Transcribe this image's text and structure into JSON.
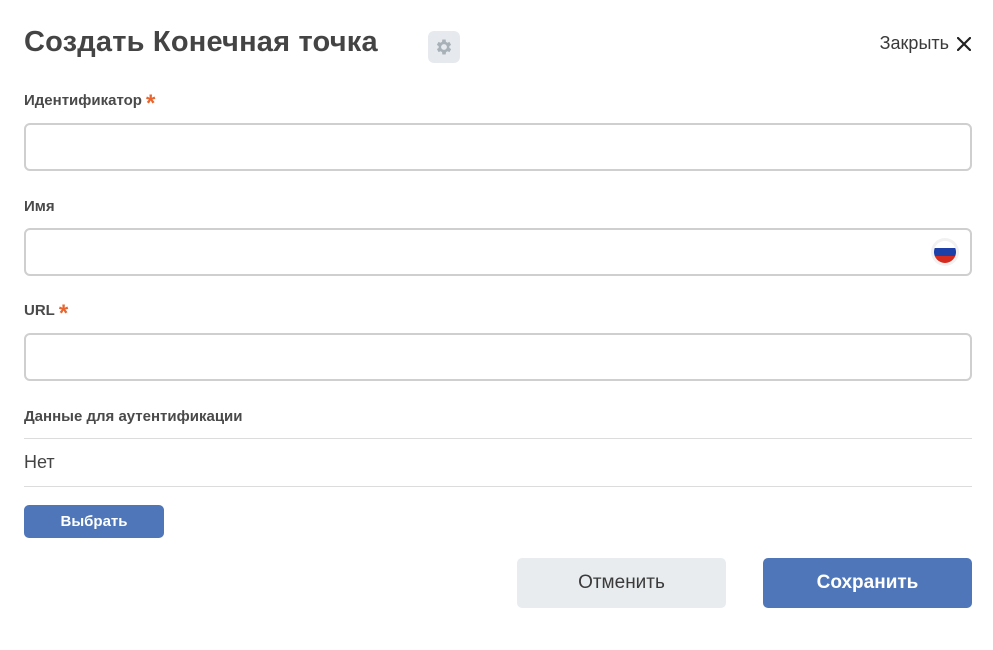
{
  "dialog": {
    "title": "Создать Конечная точка",
    "settings_icon": "gear-icon",
    "close_label": "Закрыть",
    "close_icon": "close-icon"
  },
  "form": {
    "identifier": {
      "label": "Идентификатор",
      "required_mark": "*",
      "value": ""
    },
    "name": {
      "label": "Имя",
      "value": "",
      "language_icon": "russian-flag-icon"
    },
    "url": {
      "label": "URL",
      "required_mark": "*",
      "value": ""
    },
    "auth": {
      "label": "Данные для аутентификации",
      "value": "Нет",
      "select_label": "Выбрать"
    }
  },
  "footer": {
    "cancel_label": "Отменить",
    "save_label": "Сохранить"
  },
  "colors": {
    "primary": "#4f76b8",
    "required": "#e8652e",
    "secondary_button": "#e8ecef",
    "border": "#cfcfcf"
  }
}
